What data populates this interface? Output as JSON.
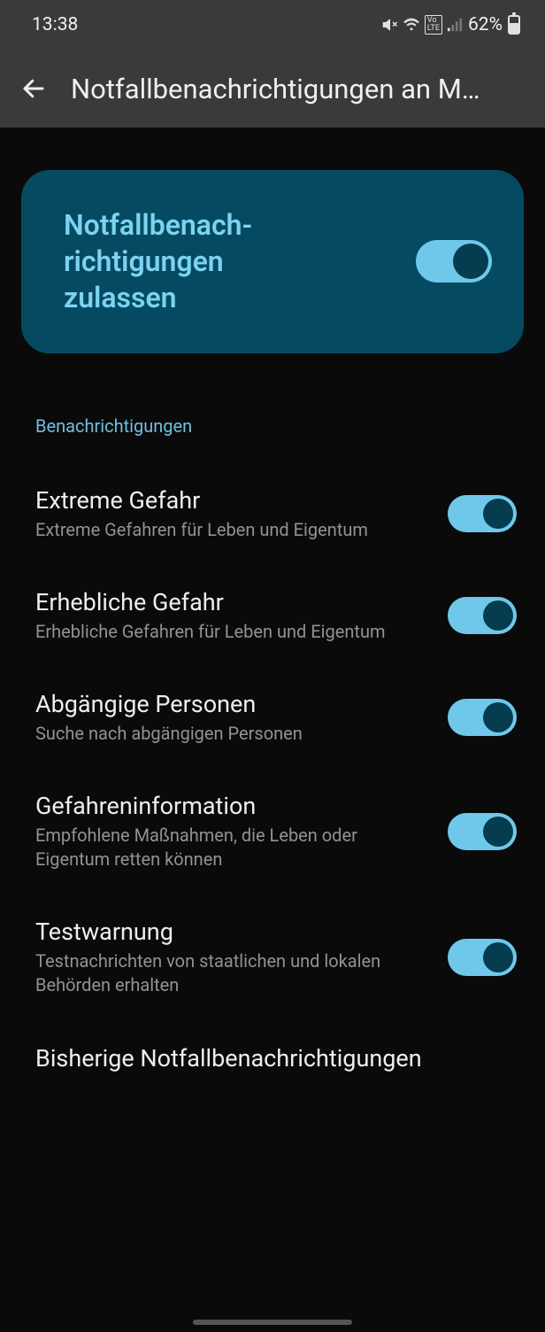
{
  "status": {
    "time": "13:38",
    "battery_pct": "62%"
  },
  "appbar": {
    "title": "Notfallbenachrichtigungen an M…"
  },
  "hero": {
    "title": "Notfallbenach-\nrichtigungen zulassen"
  },
  "section_label": "Benachrichtigungen",
  "settings": [
    {
      "title": "Extreme Gefahr",
      "sub": "Extreme Gefahren für Leben und Eigentum",
      "on": true
    },
    {
      "title": "Erhebliche Gefahr",
      "sub": "Erhebliche Gefahren für Leben und Eigentum",
      "on": true
    },
    {
      "title": "Abgängige Personen",
      "sub": "Suche nach abgängigen Personen",
      "on": true
    },
    {
      "title": "Gefahreninformation",
      "sub": "Empfohlene Maßnahmen, die Leben oder Eigentum retten können",
      "on": true
    },
    {
      "title": "Testwarnung",
      "sub": "Testnachrichten von staatlichen und lokalen Behörden erhalten",
      "on": true
    }
  ],
  "history": {
    "title": "Bisherige Notfallbenachrichtigungen"
  }
}
